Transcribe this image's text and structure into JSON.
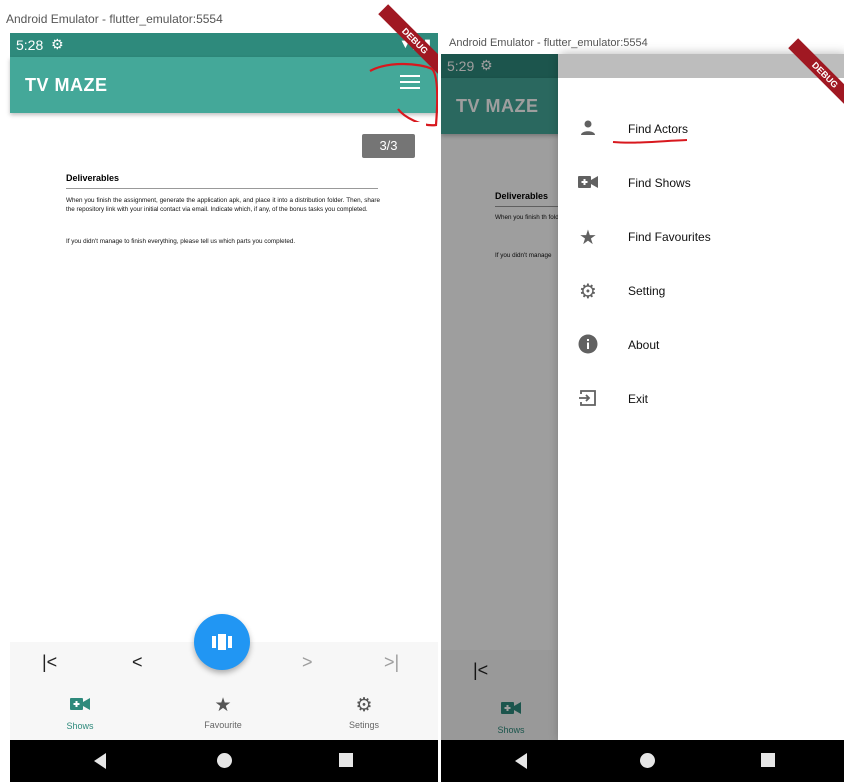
{
  "left": {
    "window_title": "Android Emulator - flutter_emulator:5554",
    "status": {
      "time": "5:28",
      "system": "▼◢▮"
    },
    "appbar": {
      "title": "TV MAZE"
    },
    "debug_banner": "DEBUG",
    "pdf": {
      "page_indicator": "3/3",
      "heading": "Deliverables",
      "paragraph_1": "When you finish the assignment, generate the application apk, and place it into a distribution folder. Then, share the repository link with your initial contact via email. Indicate which, if any, of the bonus tasks you completed.",
      "paragraph_2": "If you didn't manage to finish everything, please tell us which parts you completed."
    },
    "pager": {
      "first": "|<",
      "prev": "<",
      "next": ">",
      "last": ">|"
    },
    "bottom_nav": [
      {
        "label": "Shows",
        "icon": "video-camera-add-icon",
        "active": true
      },
      {
        "label": "Favourite",
        "icon": "star-icon",
        "active": false
      },
      {
        "label": "Setings",
        "icon": "gear-icon",
        "active": false
      }
    ],
    "colors": {
      "primary": "#44a899",
      "status": "#2e8a7c",
      "fab": "#2196f3",
      "annotation": "#d8181e"
    }
  },
  "right": {
    "window_title": "Android Emulator - flutter_emulator:5554",
    "status": {
      "time": "5:29"
    },
    "appbar": {
      "title": "TV MAZE"
    },
    "debug_banner": "DEBUG",
    "pdf": {
      "heading": "Deliverables",
      "paragraph_1": "When you finish th folder. Then, share the bonus tasks yo",
      "paragraph_2": "If you didn't manage"
    },
    "pager": {
      "first": "|<"
    },
    "bottom_nav_label": "Shows",
    "drawer": [
      {
        "label": "Find Actors",
        "icon": "person-icon"
      },
      {
        "label": "Find Shows",
        "icon": "video-camera-add-icon"
      },
      {
        "label": "Find Favourites",
        "icon": "star-icon"
      },
      {
        "label": "Setting",
        "icon": "gear-icon"
      },
      {
        "label": "About",
        "icon": "info-icon"
      },
      {
        "label": "Exit",
        "icon": "exit-icon"
      }
    ]
  }
}
